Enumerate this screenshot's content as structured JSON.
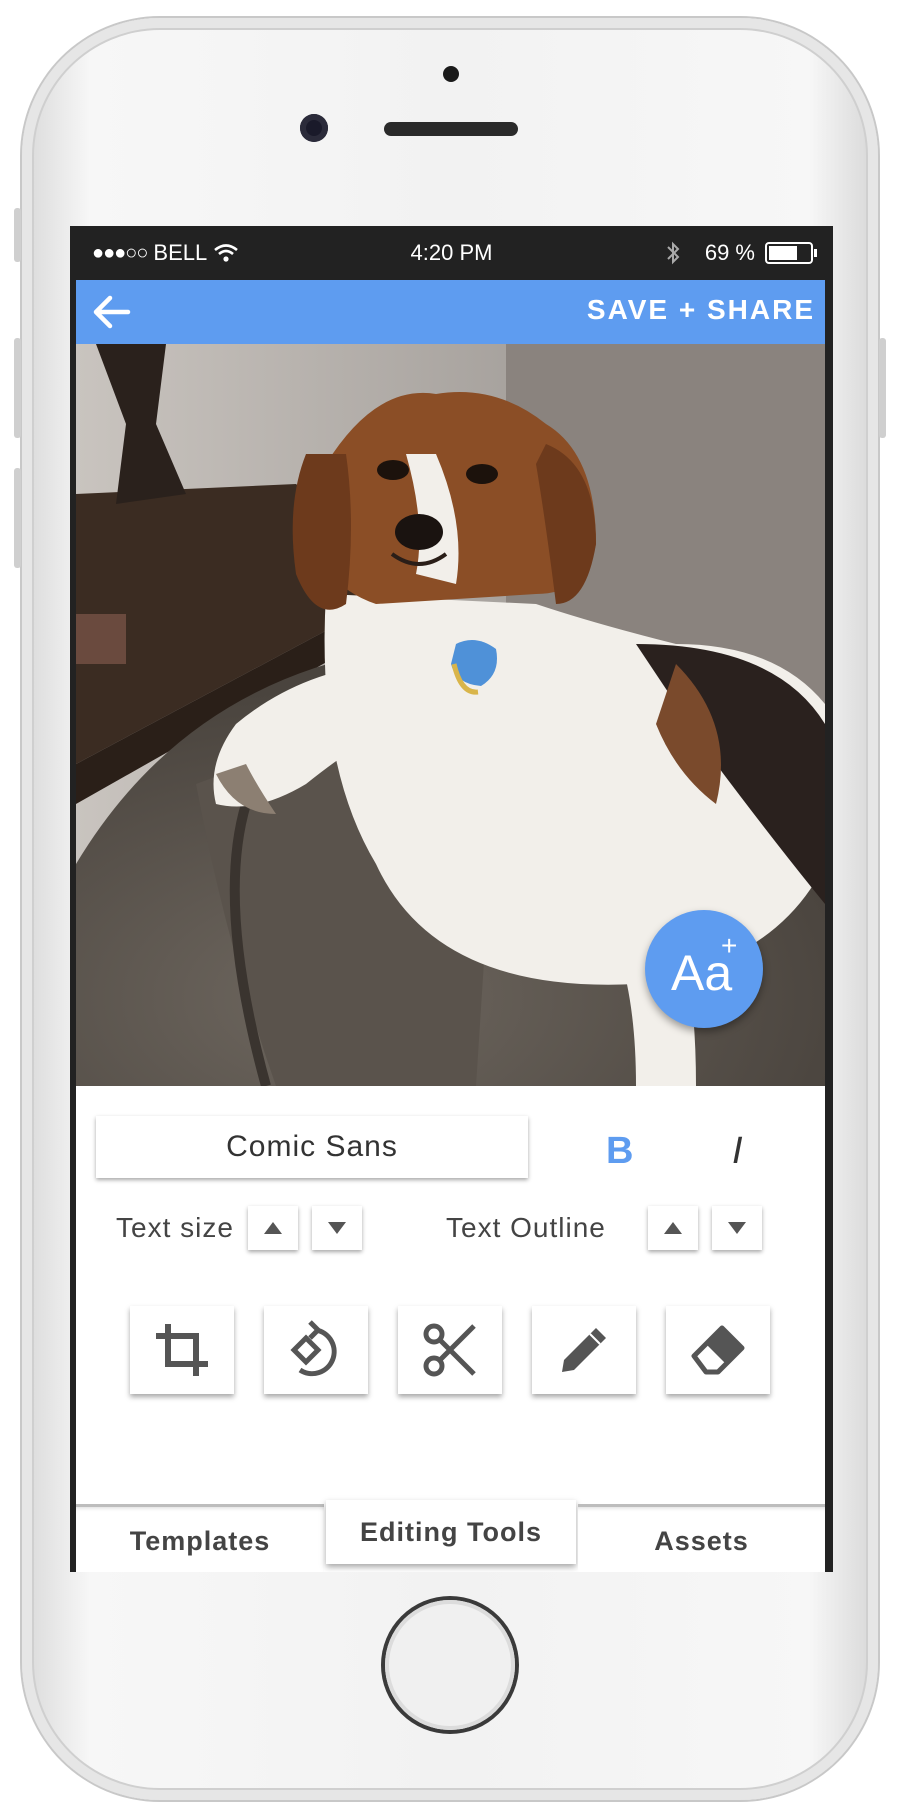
{
  "status_bar": {
    "signal": "●●●○○",
    "carrier": "BELL",
    "time": "4:20 PM",
    "battery": "69 %"
  },
  "app_bar": {
    "save_label": "SAVE + SHARE"
  },
  "add_text_button": {
    "label": "Aa",
    "plus": "+"
  },
  "font": {
    "selected": "Comic Sans"
  },
  "style": {
    "bold_label": "B",
    "italic_label": "I"
  },
  "text_size": {
    "label": "Text size"
  },
  "text_outline": {
    "label": "Text Outline"
  },
  "tools": [
    "crop-icon",
    "rotate-icon",
    "scissors-icon",
    "pencil-icon",
    "eraser-icon"
  ],
  "tabs": [
    {
      "label": "Templates"
    },
    {
      "label": "Editing Tools",
      "active": true
    },
    {
      "label": "Assets"
    }
  ],
  "colors": {
    "accent": "#5e9cf0",
    "status_bg": "#222222"
  }
}
